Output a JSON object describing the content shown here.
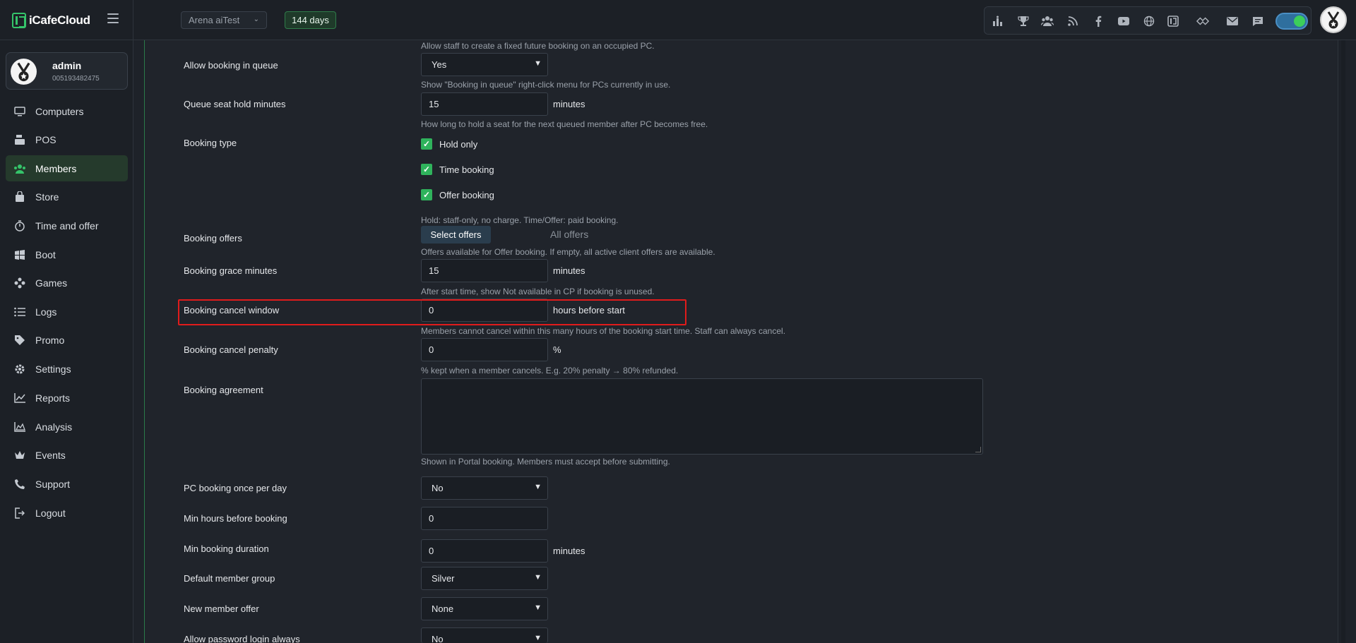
{
  "app": {
    "name": "iCafeCloud"
  },
  "header": {
    "cafe_selector": "Arena aiTest",
    "days_badge": "144 days",
    "toolbar_icons": [
      "ranking-icon",
      "trophy-icon",
      "group-icon",
      "rss-icon",
      "facebook-icon",
      "youtube-icon",
      "globe-icon",
      "icafe-icon",
      "handshake-icon",
      "mail-icon",
      "chat-icon"
    ],
    "theme_toggle": "on"
  },
  "profile": {
    "name": "admin",
    "id": "005193482475"
  },
  "sidebar": {
    "items": [
      {
        "label": "Computers",
        "icon": "monitor-icon"
      },
      {
        "label": "POS",
        "icon": "cash-register-icon"
      },
      {
        "label": "Members",
        "icon": "users-icon",
        "active": true
      },
      {
        "label": "Store",
        "icon": "bag-icon"
      },
      {
        "label": "Time and offer",
        "icon": "stopwatch-icon"
      },
      {
        "label": "Boot",
        "icon": "windows-icon"
      },
      {
        "label": "Games",
        "icon": "gamepad-icon"
      },
      {
        "label": "Logs",
        "icon": "list-icon"
      },
      {
        "label": "Promo",
        "icon": "tag-icon"
      },
      {
        "label": "Settings",
        "icon": "gear-icon"
      },
      {
        "label": "Reports",
        "icon": "chart-line-icon"
      },
      {
        "label": "Analysis",
        "icon": "chart-area-icon"
      },
      {
        "label": "Events",
        "icon": "crown-icon"
      },
      {
        "label": "Support",
        "icon": "phone-icon"
      },
      {
        "label": "Logout",
        "icon": "logout-icon"
      }
    ]
  },
  "settings": {
    "help_fixed_future": "Allow staff to create a fixed future booking on an occupied PC.",
    "allow_queue": {
      "label": "Allow booking in queue",
      "value": "Yes",
      "help": "Show \"Booking in queue\" right-click menu for PCs currently in use."
    },
    "queue_hold": {
      "label": "Queue seat hold minutes",
      "value": "15",
      "unit": "minutes",
      "help": "How long to hold a seat for the next queued member after PC becomes free."
    },
    "booking_type": {
      "label": "Booking type",
      "options": [
        "Hold only",
        "Time booking",
        "Offer booking"
      ],
      "help": "Hold: staff-only, no charge. Time/Offer: paid booking."
    },
    "booking_offers": {
      "label": "Booking offers",
      "button": "Select offers",
      "value": "All offers",
      "help": "Offers available for Offer booking. If empty, all active client offers are available."
    },
    "grace": {
      "label": "Booking grace minutes",
      "value": "15",
      "unit": "minutes",
      "help": "After start time, show Not available in CP if booking is unused."
    },
    "cancel_window": {
      "label": "Booking cancel window",
      "value": "0",
      "unit": "hours before start",
      "help": "Members cannot cancel within this many hours of the booking start time. Staff can always cancel."
    },
    "cancel_penalty": {
      "label": "Booking cancel penalty",
      "value": "0",
      "unit": "%",
      "help": "% kept when a member cancels. E.g. 20% penalty → 80% refunded."
    },
    "agreement": {
      "label": "Booking agreement",
      "value": "",
      "help": "Shown in Portal booking. Members must accept before submitting."
    },
    "once_per_day": {
      "label": "PC booking once per day",
      "value": "No"
    },
    "min_hours": {
      "label": "Min hours before booking",
      "value": "0"
    },
    "min_duration": {
      "label": "Min booking duration",
      "value": "0",
      "unit": "minutes"
    },
    "default_group": {
      "label": "Default member group",
      "value": "Silver"
    },
    "new_member_offer": {
      "label": "New member offer",
      "value": "None"
    },
    "password_login": {
      "label": "Allow password login always",
      "value": "No"
    }
  },
  "colors": {
    "accent": "#35c46a",
    "highlight": "#e01b1b",
    "background": "#20242b"
  }
}
